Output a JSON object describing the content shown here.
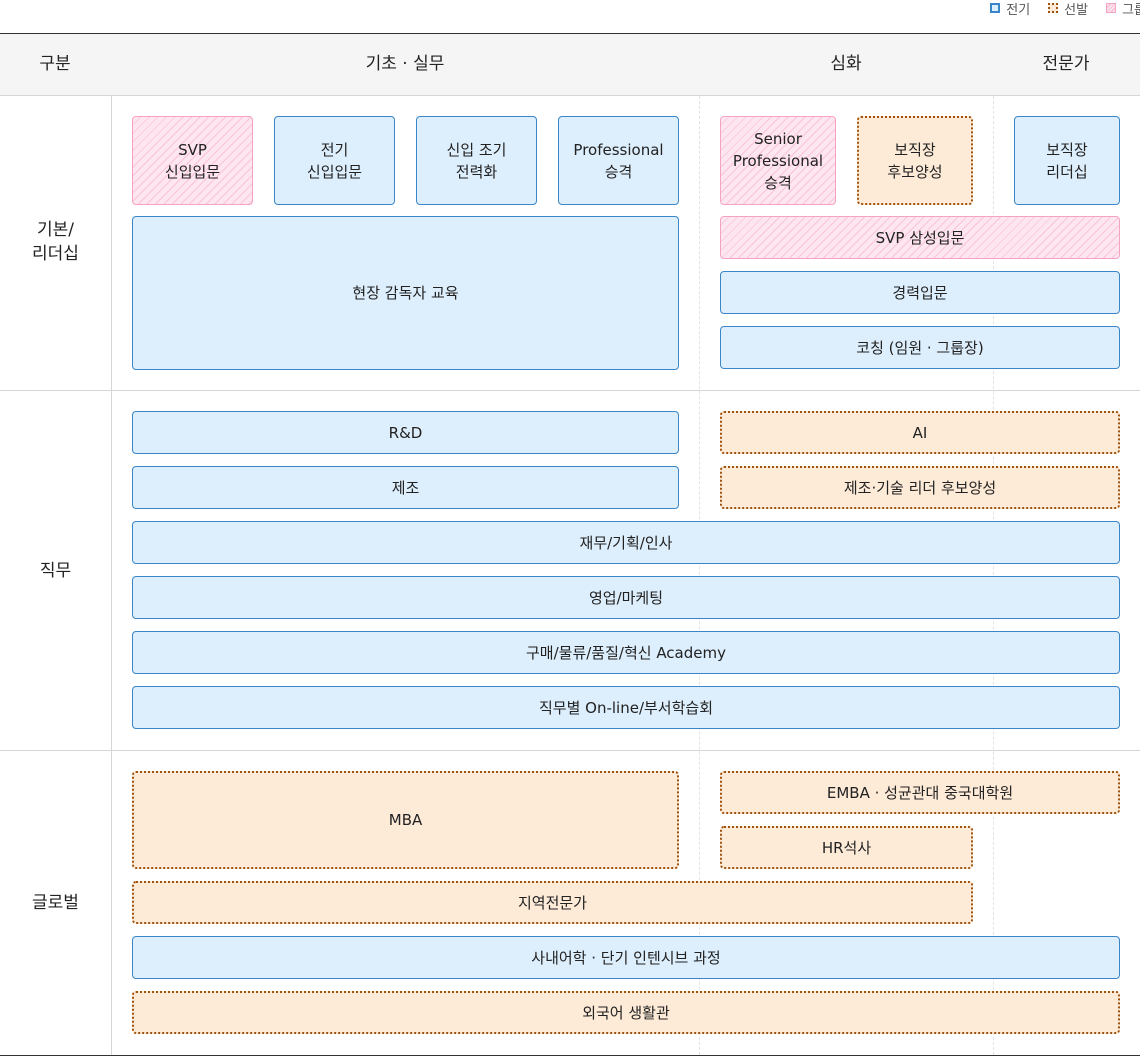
{
  "legend": [
    {
      "label": "전기",
      "style": "blue"
    },
    {
      "label": "선발",
      "style": "orange"
    },
    {
      "label": "그룹",
      "style": "pink"
    }
  ],
  "colors": {
    "blue_border": "#3a86c8",
    "blue_fill": "#ddeefc",
    "orange_border": "#a0520f",
    "orange_fill": "#fdebd8",
    "pink_border": "#f5a3c4",
    "pink_fill": "#fde6ef"
  },
  "header": {
    "category": "구분",
    "basic": "기초 · 실무",
    "advanced": "심화",
    "expert": "전문가"
  },
  "rows": {
    "leadership": "기본/\n리더십",
    "job": "직무",
    "global": "글로벌"
  },
  "boxes": {
    "svp_intro": "SVP\n신입입문",
    "elec_intro": "전기\n신입입문",
    "early": "신입 조기\n전력화",
    "pro": "Professional\n승격",
    "senior": "Senior\nProfessional\n승격",
    "manager_cand": "보직장\n후보양성",
    "manager_lead": "보직장\n리더십",
    "field": "현장 감독자 교육",
    "svp_samsung": "SVP 삼성입문",
    "career": "경력입문",
    "coaching": "코칭 (임원 · 그룹장)",
    "rnd": "R&D",
    "mfg": "제조",
    "ai": "AI",
    "mfg_leader": "제조·기술 리더 후보양성",
    "finance": "재무/기획/인사",
    "sales": "영업/마케팅",
    "purchase": "구매/물류/품질/혁신 Academy",
    "online": "직무별 On-line/부서학습회",
    "mba": "MBA",
    "emba": "EMBA · 성균관대 중국대학원",
    "hr": "HR석사",
    "regional": "지역전문가",
    "language": "사내어학 · 단기 인텐시브 과정",
    "foreign": "외국어 생활관"
  }
}
